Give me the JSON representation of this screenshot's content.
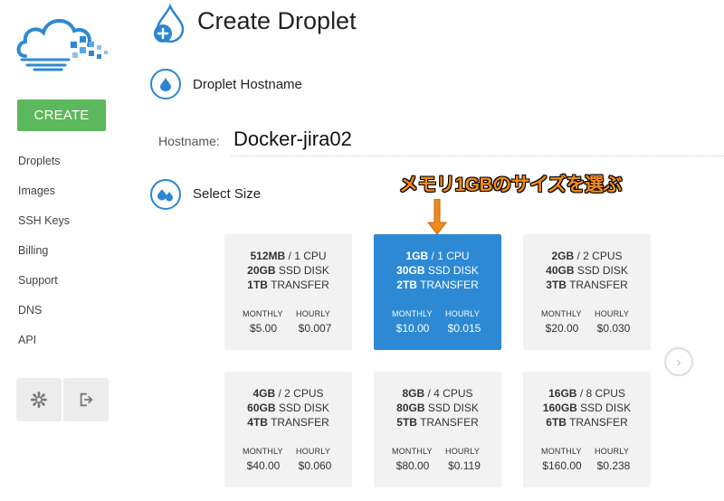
{
  "sidebar": {
    "create_label": "CREATE",
    "items": [
      {
        "label": "Droplets"
      },
      {
        "label": "Images"
      },
      {
        "label": "SSH Keys"
      },
      {
        "label": "Billing"
      },
      {
        "label": "Support"
      },
      {
        "label": "DNS"
      },
      {
        "label": "API"
      }
    ],
    "settings_icon": "gear-icon",
    "logout_icon": "logout-icon"
  },
  "header": {
    "title": "Create Droplet"
  },
  "hostname_section": {
    "title": "Droplet Hostname",
    "label": "Hostname:",
    "value": "Docker-jira02"
  },
  "size_section": {
    "title": "Select Size",
    "annotation": "メモリ1GBのサイズを選ぶ",
    "sizes": [
      {
        "mem": "512MB",
        "cpu": "1 CPU",
        "disk": "20GB",
        "transfer": "1TB",
        "monthly": "$5.00",
        "hourly": "$0.007",
        "selected": false
      },
      {
        "mem": "1GB",
        "cpu": "1 CPU",
        "disk": "30GB",
        "transfer": "2TB",
        "monthly": "$10.00",
        "hourly": "$0.015",
        "selected": true
      },
      {
        "mem": "2GB",
        "cpu": "2 CPUS",
        "disk": "40GB",
        "transfer": "3TB",
        "monthly": "$20.00",
        "hourly": "$0.030",
        "selected": false
      },
      {
        "mem": "4GB",
        "cpu": "2 CPUS",
        "disk": "60GB",
        "transfer": "4TB",
        "monthly": "$40.00",
        "hourly": "$0.060",
        "selected": false
      },
      {
        "mem": "8GB",
        "cpu": "4 CPUS",
        "disk": "80GB",
        "transfer": "5TB",
        "monthly": "$80.00",
        "hourly": "$0.119",
        "selected": false
      },
      {
        "mem": "16GB",
        "cpu": "8 CPUS",
        "disk": "160GB",
        "transfer": "6TB",
        "monthly": "$160.00",
        "hourly": "$0.238",
        "selected": false
      }
    ],
    "spec_sep": "/",
    "disk_suffix": "SSD DISK",
    "transfer_suffix": "TRANSFER",
    "monthly_label": "MONTHLY",
    "hourly_label": "HOURLY",
    "next_icon": "chevron-right-icon"
  },
  "colors": {
    "accent": "#2d89d3",
    "create": "#5cb85c",
    "annotation": "#f08a1c"
  }
}
